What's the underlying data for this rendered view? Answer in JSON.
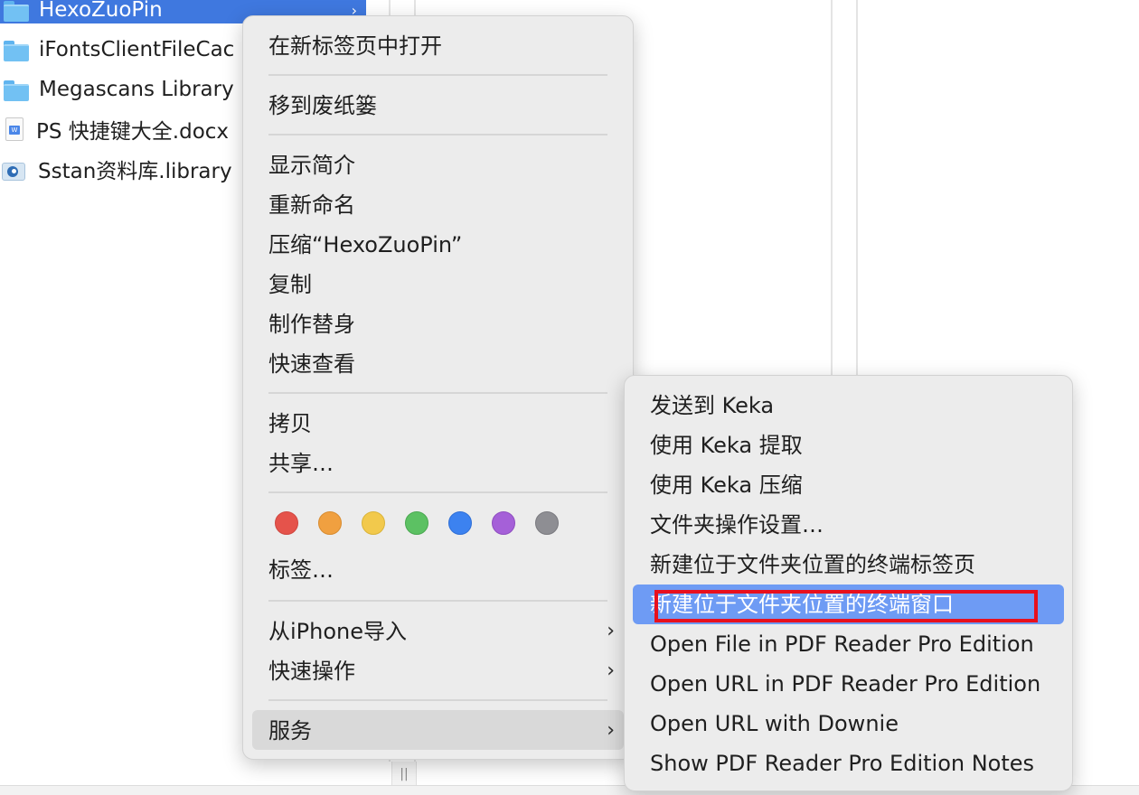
{
  "finder": {
    "files": [
      {
        "name": "HexoZuoPin",
        "kind": "folder",
        "selected": true
      },
      {
        "name": "iFontsClientFileCac",
        "kind": "folder",
        "selected": false
      },
      {
        "name": "Megascans Library",
        "kind": "folder",
        "selected": false
      },
      {
        "name": "PS 快捷键大全.docx",
        "kind": "doc",
        "selected": false
      },
      {
        "name": "Sstan资料库.library",
        "kind": "library",
        "selected": false
      }
    ],
    "selected_chevron": "›",
    "resize_handle": "||"
  },
  "context_menu": {
    "open_in_new_tab": "在新标签页中打开",
    "move_to_trash": "移到废纸篓",
    "get_info": "显示简介",
    "rename": "重新命名",
    "compress": "压缩“HexoZuoPin”",
    "duplicate": "复制",
    "make_alias": "制作替身",
    "quick_look": "快速查看",
    "copy": "拷贝",
    "share": "共享…",
    "tags_label": "标签…",
    "import_from_iphone": "从iPhone导入",
    "quick_actions": "快速操作",
    "services": "服务",
    "arrow": "›",
    "tag_colors": [
      "#e5534b",
      "#f0a040",
      "#f2c94c",
      "#5cc163",
      "#3c82f0",
      "#a560d8",
      "#8e8e93"
    ]
  },
  "services_menu": {
    "items": [
      "发送到 Keka",
      "使用 Keka 提取",
      "使用 Keka 压缩",
      "文件夹操作设置…",
      "新建位于文件夹位置的终端标签页",
      "新建位于文件夹位置的终端窗口",
      "Open File in PDF Reader Pro Edition",
      "Open URL in PDF Reader Pro Edition",
      "Open URL with Downie",
      "Show PDF Reader Pro Edition Notes"
    ],
    "highlighted_index": 5
  },
  "colors": {
    "highlight": "#6e9bf4",
    "services_row_bg": "#d9d9d9",
    "annotation_box": "#e8101d",
    "selection": "#3f78df"
  }
}
